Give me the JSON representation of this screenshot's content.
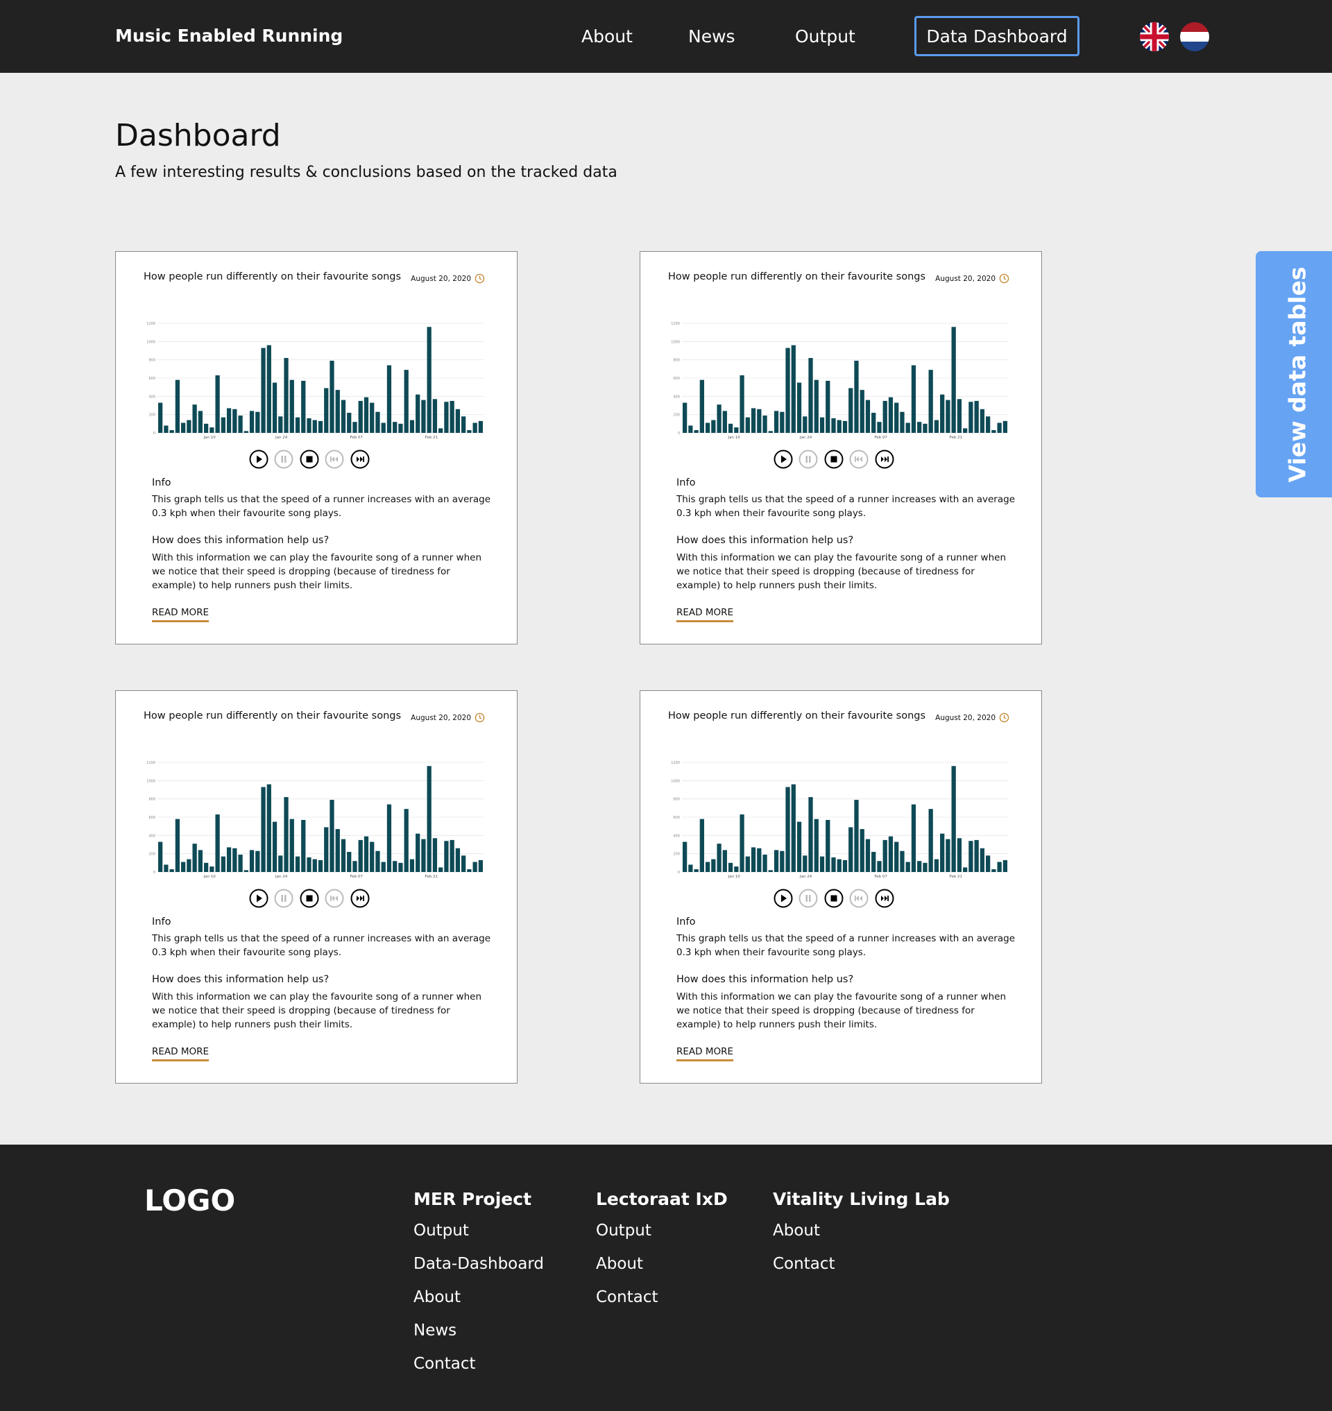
{
  "header": {
    "brand": "Music Enabled Running",
    "nav": {
      "about": "About",
      "news": "News",
      "output": "Output",
      "dashboard": "Data Dashboard"
    }
  },
  "intro": {
    "title": "Dashboard",
    "subtitle": "A few interesting results & conclusions based on the tracked data"
  },
  "side_tab": {
    "label": "View data tables"
  },
  "card": {
    "title": "How people run differently on their favourite songs",
    "date": "August 20, 2020",
    "info_heading": "Info",
    "info_text": "This graph tells us that the speed of a runner increases with an average 0.3 kph when their favourite song plays.",
    "help_heading": "How does this information help us?",
    "help_text": "With this information we can play the favourite song of a runner when we notice that their speed is dropping (because of tiredness for example) to help runners push their limits.",
    "read_more": "READ MORE"
  },
  "chart_data": {
    "type": "bar",
    "x_ticks": [
      "Jan 10",
      "Jan 24",
      "Feb 07",
      "Feb 21"
    ],
    "y_ticks": [
      "0",
      "200",
      "400",
      "600",
      "800",
      "1000",
      "1200"
    ],
    "ylim": [
      0,
      1200
    ],
    "values": [
      330,
      80,
      30,
      580,
      110,
      140,
      310,
      240,
      100,
      60,
      630,
      170,
      270,
      260,
      190,
      20,
      240,
      230,
      930,
      960,
      550,
      180,
      820,
      580,
      170,
      570,
      160,
      140,
      130,
      490,
      790,
      470,
      360,
      220,
      120,
      350,
      390,
      330,
      230,
      110,
      740,
      120,
      100,
      690,
      140,
      420,
      360,
      1160,
      370,
      50,
      340,
      350,
      260,
      180,
      30,
      110,
      130
    ],
    "color": "#0e4a56"
  },
  "footer": {
    "logo": "LOGO",
    "columns": [
      {
        "heading": "MER Project",
        "links": [
          "Output",
          "Data-Dashboard",
          "About",
          "News",
          "Contact"
        ]
      },
      {
        "heading": "Lectoraat IxD",
        "links": [
          "Output",
          "About",
          "Contact"
        ]
      },
      {
        "heading": "Vitality Living Lab",
        "links": [
          "About",
          "Contact"
        ]
      }
    ]
  },
  "icons": {
    "flags": [
      "uk-flag-icon",
      "nl-flag-icon"
    ],
    "controls": [
      "play-icon",
      "pause-icon",
      "stop-icon",
      "previous-icon",
      "next-icon"
    ],
    "date": "clock-icon"
  },
  "colors": {
    "header_bg": "#222222",
    "accent_blue": "#66a3f3",
    "bar_color": "#0e4a56",
    "underline_orange": "#c88b3a"
  }
}
